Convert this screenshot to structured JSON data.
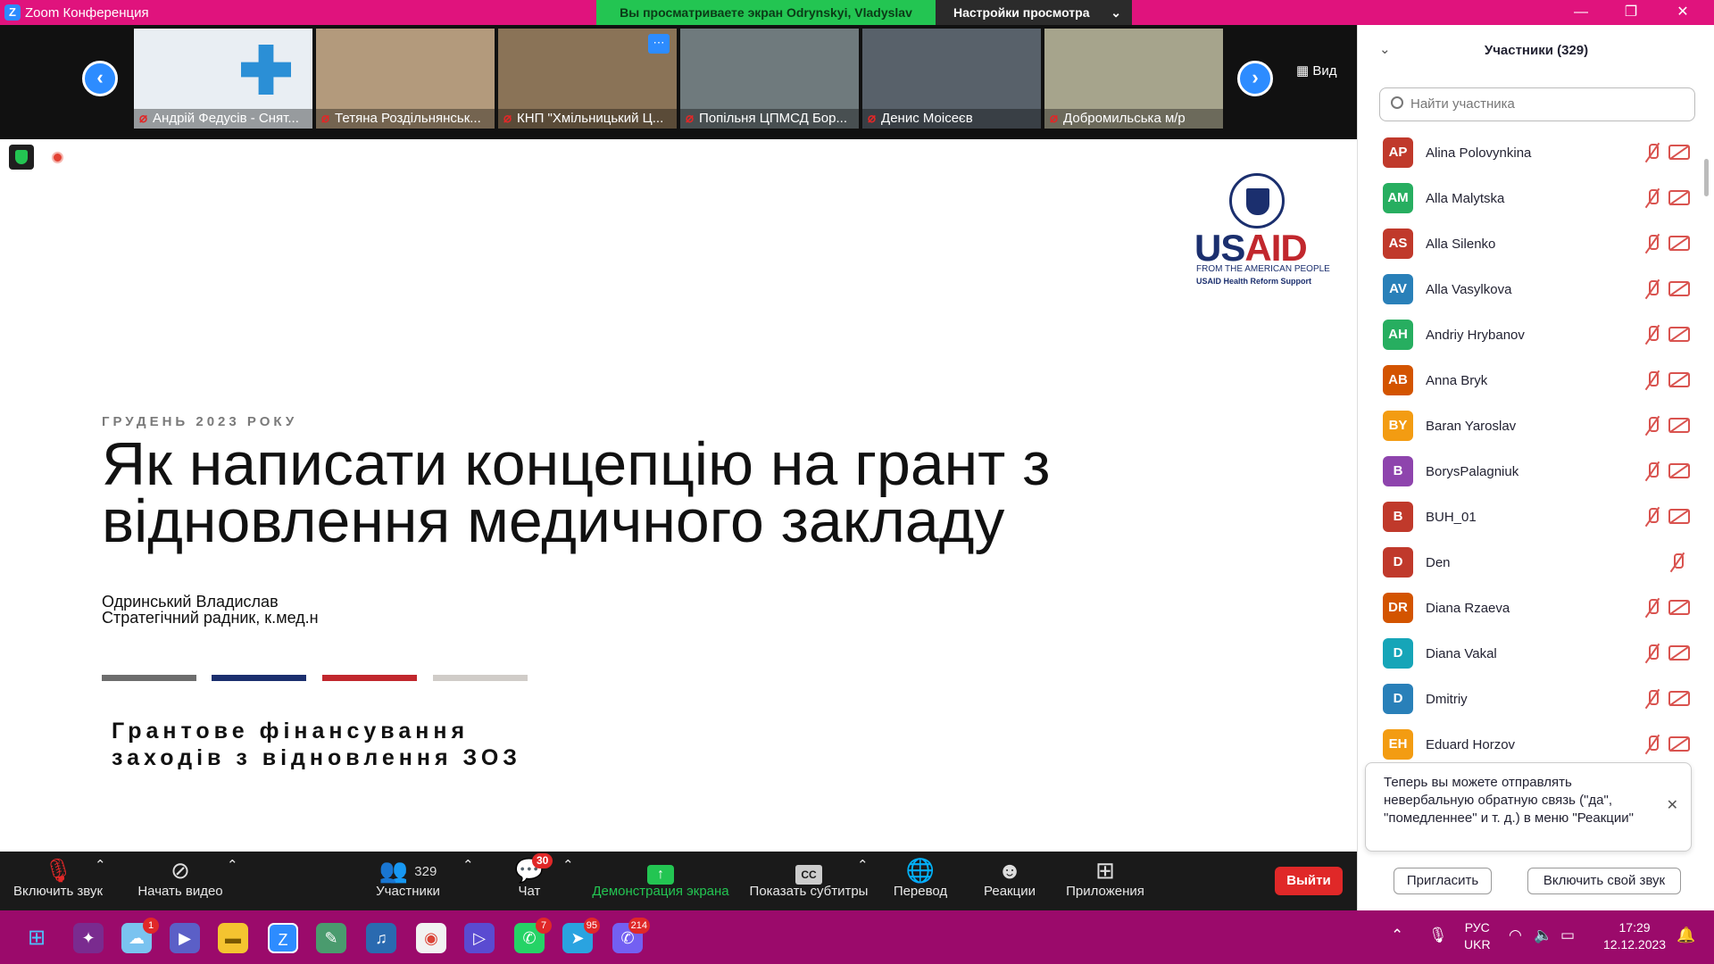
{
  "window": {
    "title": "Zoom Конференция",
    "share_banner": "Вы просматриваете экран Odrynskyi, Vladyslav",
    "view_options": "Настройки просмотра"
  },
  "filmstrip": {
    "view_label": "Вид",
    "tiles": [
      {
        "name": "Андрій Федусів - Снят..."
      },
      {
        "name": "Тетяна Роздільнянськ..."
      },
      {
        "name": "КНП \"Хмільницький Ц..."
      },
      {
        "name": "Попільня ЦПМСД Бор..."
      },
      {
        "name": "Денис Моісеєв"
      },
      {
        "name": "Добромильська м/р"
      }
    ]
  },
  "slide": {
    "date": "ГРУДЕНЬ 2023 РОКУ",
    "title_line1": "Як написати концепцію на грант з",
    "title_line2": "відновлення медичного закладу",
    "author": "Одринський Владислав",
    "role": "Стратегічний радник, к.мед.н",
    "subtitle_line1": "Грантове фінансування",
    "subtitle_line2": "заходів з відновлення ЗОЗ",
    "logo": {
      "us": "US",
      "aid": "AID",
      "line1": "FROM THE AMERICAN PEOPLE",
      "line2": "USAID Health Reform Support"
    },
    "bar_colors": [
      "#6d6d6d",
      "#1b2f6e",
      "#c1272d",
      "#d0ccc8"
    ]
  },
  "toolbar": {
    "mute": "Включить звук",
    "video": "Начать видео",
    "participants": "Участники",
    "participants_count": "329",
    "chat": "Чат",
    "chat_badge": "30",
    "share": "Демонстрация экрана",
    "captions": "Показать субтитры",
    "translate": "Перевод",
    "reactions": "Реакции",
    "apps": "Приложения",
    "exit": "Выйти"
  },
  "panel": {
    "title": "Участники (329)",
    "search_placeholder": "Найти участника",
    "participants": [
      {
        "initials": "AP",
        "name": "Alina Polovynkina",
        "color": "#c0392b"
      },
      {
        "initials": "AM",
        "name": "Alla Malytska",
        "color": "#27ae60"
      },
      {
        "initials": "AS",
        "name": "Alla Silenko",
        "color": "#c0392b"
      },
      {
        "initials": "AV",
        "name": "Alla Vasylkova",
        "color": "#2980b9"
      },
      {
        "initials": "AH",
        "name": "Andriy Hrybanov",
        "color": "#27ae60"
      },
      {
        "initials": "AB",
        "name": "Anna Bryk",
        "color": "#d35400"
      },
      {
        "initials": "BY",
        "name": "Baran Yaroslav",
        "color": "#f39c12"
      },
      {
        "initials": "B",
        "name": "BorysPalagniuk",
        "color": "#8e44ad"
      },
      {
        "initials": "B",
        "name": "BUH_01",
        "color": "#c0392b"
      },
      {
        "initials": "D",
        "name": "Den",
        "color": "#c0392b"
      },
      {
        "initials": "DR",
        "name": "Diana Rzaeva",
        "color": "#d35400"
      },
      {
        "initials": "D",
        "name": "Diana Vakal",
        "color": "#16a5b8"
      },
      {
        "initials": "D",
        "name": "Dmitriy",
        "color": "#2980b9"
      },
      {
        "initials": "EH",
        "name": "Eduard Horzov",
        "color": "#f39c12"
      }
    ],
    "tooltip_line1": "Теперь вы можете отправлять",
    "tooltip_line2": "невербальную обратную связь (\"да\",",
    "tooltip_line3": "\"помедленнее\" и т. д.) в меню \"Реакции\"",
    "invite": "Пригласить",
    "unmute_me": "Включить свой звук"
  },
  "taskbar": {
    "lang1": "РУС",
    "lang2": "UKR",
    "time": "17:29",
    "date": "12.12.2023",
    "badges": {
      "cloud": "1",
      "whatsapp": "7",
      "telegram": "95",
      "viber": "214"
    }
  }
}
